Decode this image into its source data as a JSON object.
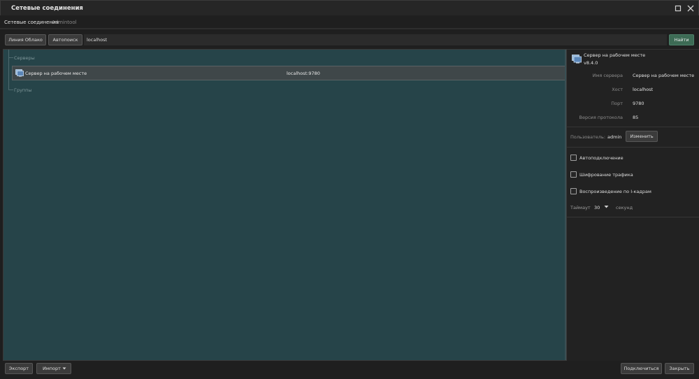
{
  "window": {
    "title": "Сетевые соединения",
    "maximize_icon": "maximize-icon",
    "close_icon": "close-icon"
  },
  "tabs": [
    {
      "label": "Сетевые соединения",
      "active": true
    },
    {
      "label": "Admintool",
      "active": false
    }
  ],
  "toolbar": {
    "cloud_button": "Линия Облако",
    "autosearch_button": "Автопоиск",
    "search_value": "localhost",
    "find_button": "Найти"
  },
  "tree": {
    "servers_group": "Серверы",
    "groups_group": "Группы",
    "server": {
      "icon": "server-monitor-icon",
      "name": "Сервер на рабочем месте",
      "address": "localhost:9780"
    }
  },
  "details": {
    "server_name": "Сервер на рабочем месте",
    "version": "v8.4.0",
    "fields": {
      "name_label": "Имя сервера",
      "name_value": "Сервер на рабочем месте",
      "host_label": "Хост",
      "host_value": "localhost",
      "port_label": "Порт",
      "port_value": "9780",
      "protocol_label": "Версия протокола",
      "protocol_value": "85"
    },
    "user_label": "Пользователь:",
    "user_value": "admin",
    "change_button": "Изменить",
    "options": {
      "autoconnect": "Автоподключение",
      "encryption": "Шифрование трафика",
      "iframe_playback": "Воспроизведение по I-кадрам"
    },
    "timeout_label": "Таймаут",
    "timeout_value": "30",
    "timeout_unit": "секунд"
  },
  "footer": {
    "export_button": "Экспорт",
    "import_button": "Импорт",
    "connect_button": "Подключиться",
    "close_button": "Закрыть"
  }
}
